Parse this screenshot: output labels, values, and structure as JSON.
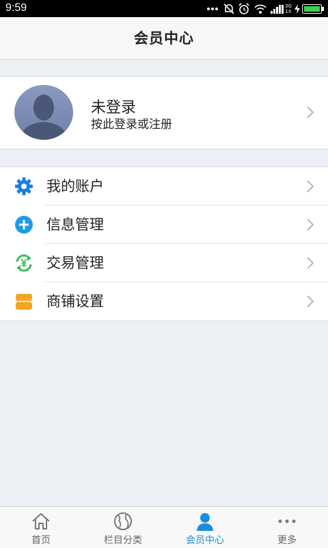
{
  "status_bar": {
    "time": "9:59",
    "network_label": "3G",
    "signal_sub": "1X"
  },
  "header": {
    "title": "会员中心"
  },
  "profile": {
    "name": "未登录",
    "subtitle": "按此登录或注册"
  },
  "menu": {
    "items": [
      {
        "label": "我的账户",
        "icon": "gear-icon",
        "color": "#1a7fe0"
      },
      {
        "label": "信息管理",
        "icon": "plus-circle-icon",
        "color": "#1e9be8"
      },
      {
        "label": "交易管理",
        "icon": "yen-exchange-icon",
        "color": "#3dbd5d"
      },
      {
        "label": "商铺设置",
        "icon": "shop-icon",
        "color": "#f2a422"
      }
    ]
  },
  "tabbar": {
    "tabs": [
      {
        "label": "首页",
        "icon": "home-icon"
      },
      {
        "label": "栏目分类",
        "icon": "globe-icon"
      },
      {
        "label": "会员中心",
        "icon": "person-icon",
        "active": true
      },
      {
        "label": "更多",
        "icon": "more-icon"
      }
    ],
    "active_color": "#1a8de0"
  }
}
